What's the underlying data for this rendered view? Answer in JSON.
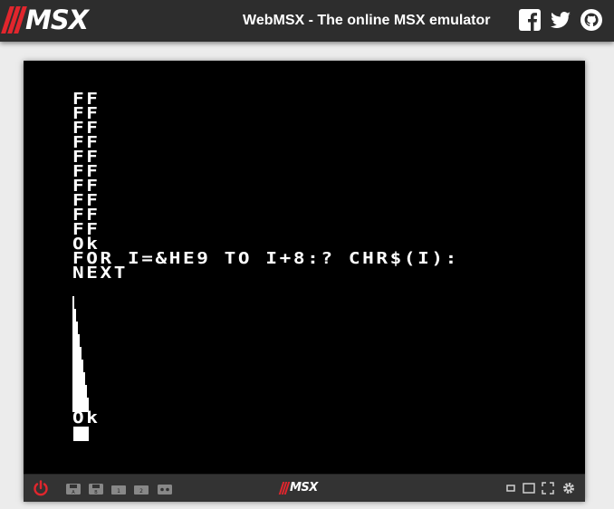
{
  "header": {
    "logo_text": "MSX",
    "title": "WebMSX - The online MSX emulator",
    "social": [
      "facebook-icon",
      "twitter-icon",
      "github-icon"
    ]
  },
  "screen": {
    "lines": [
      "FF",
      "FF",
      "FF",
      "FF",
      "FF",
      "FF",
      "FF",
      "FF",
      "FF",
      "FF",
      "Ok",
      "FOR I=&HE9 TO I+8:? CHR$(I):",
      "NEXT",
      "Ok"
    ],
    "foreground": "#ffffff",
    "background": "#000000"
  },
  "controlbar": {
    "logo_text": "MSX",
    "left_buttons": [
      "power-icon",
      "disk-a-icon",
      "disk-b-icon",
      "cartridge-1-icon",
      "cartridge-2-icon",
      "tape-icon"
    ],
    "right_buttons": [
      "screen-small-icon",
      "screen-large-icon",
      "fullscreen-icon",
      "settings-icon"
    ]
  },
  "colors": {
    "header_bg": "#2d2d2d",
    "page_bg": "#ececec",
    "brand_red": "#e1262d",
    "control_bar_bg": "#333333"
  }
}
